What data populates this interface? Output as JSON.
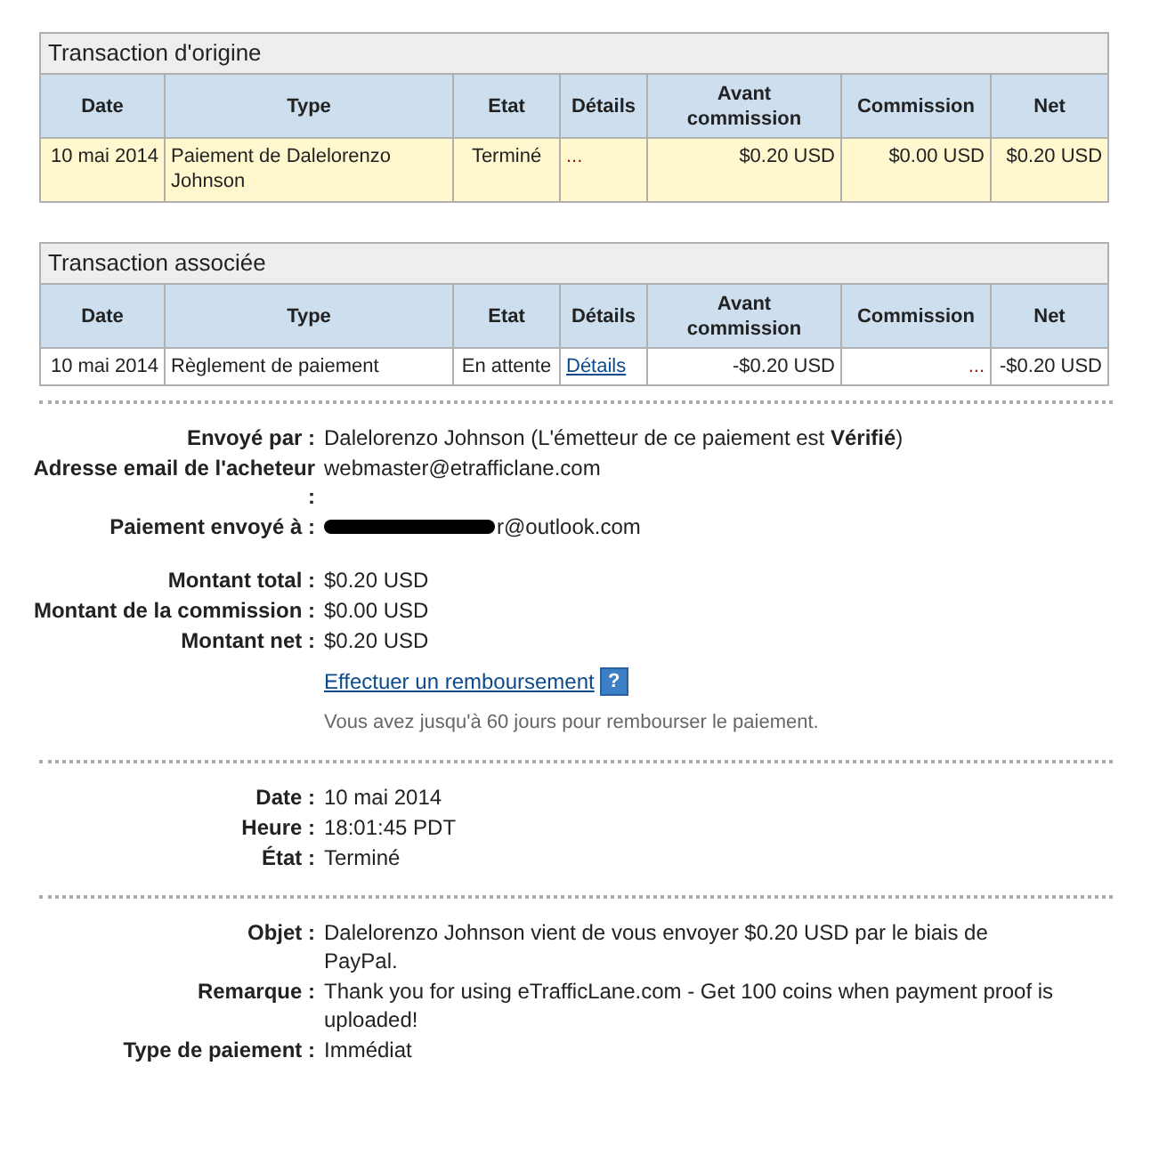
{
  "tables": [
    {
      "title": "Transaction d'origine",
      "highlight": true,
      "columns": [
        "Date",
        "Type",
        "Etat",
        "Détails",
        "Avant commission",
        "Commission",
        "Net"
      ],
      "rows": [
        [
          {
            "text": "10 mai 2014"
          },
          {
            "text": "Paiement de Dalelorenzo Johnson"
          },
          {
            "text": "Terminé"
          },
          {
            "text": "...",
            "kind": "ellipsis"
          },
          {
            "text": "$0.20 USD"
          },
          {
            "text": "$0.00 USD"
          },
          {
            "text": "$0.20 USD"
          }
        ]
      ]
    },
    {
      "title": "Transaction associée",
      "highlight": false,
      "columns": [
        "Date",
        "Type",
        "Etat",
        "Détails",
        "Avant commission",
        "Commission",
        "Net"
      ],
      "rows": [
        [
          {
            "text": "10 mai 2014"
          },
          {
            "text": "Règlement de paiement"
          },
          {
            "text": "En attente"
          },
          {
            "text": "Détails",
            "kind": "link"
          },
          {
            "text": "-$0.20 USD"
          },
          {
            "text": "...",
            "kind": "ellipsis"
          },
          {
            "text": "-$0.20 USD"
          }
        ]
      ]
    }
  ],
  "sections": [
    {
      "groups": [
        [
          {
            "kind": "field",
            "label": "Envoyé par :",
            "value": "Dalelorenzo Johnson (L'émetteur de ce paiement est **Vérifié**)"
          },
          {
            "kind": "field",
            "label": "Adresse email de l'acheteur :",
            "value": "webmaster@etrafficlane.com"
          },
          {
            "kind": "field",
            "label": "Paiement envoyé à :",
            "value": "r@outlook.com",
            "redacted": true
          }
        ],
        [
          {
            "kind": "field",
            "label": "Montant total :",
            "value": "$0.20 USD"
          },
          {
            "kind": "field",
            "label": "Montant de la commission :",
            "value": "$0.00 USD"
          },
          {
            "kind": "field",
            "label": "Montant net :",
            "value": "$0.20 USD"
          },
          {
            "kind": "link",
            "value": "Effectuer un remboursement",
            "help": "?"
          },
          {
            "kind": "note",
            "value": "Vous avez jusqu'à 60 jours pour rembourser le paiement."
          }
        ]
      ]
    },
    {
      "groups": [
        [
          {
            "kind": "field",
            "label": "Date :",
            "value": "10 mai 2014"
          },
          {
            "kind": "field",
            "label": "Heure :",
            "value": "18:01:45 PDT"
          },
          {
            "kind": "field",
            "label": "État :",
            "value": "Terminé"
          }
        ]
      ]
    },
    {
      "groups": [
        [
          {
            "kind": "field",
            "label": "Objet :",
            "value": "Dalelorenzo Johnson vient de vous envoyer $0.20 USD par le biais de PayPal."
          },
          {
            "kind": "field",
            "label": "Remarque :",
            "value": "Thank you for using eTrafficLane.com - Get 100 coins when payment proof is uploaded!"
          },
          {
            "kind": "field",
            "label": "Type de paiement :",
            "value": "Immédiat"
          }
        ]
      ]
    }
  ]
}
